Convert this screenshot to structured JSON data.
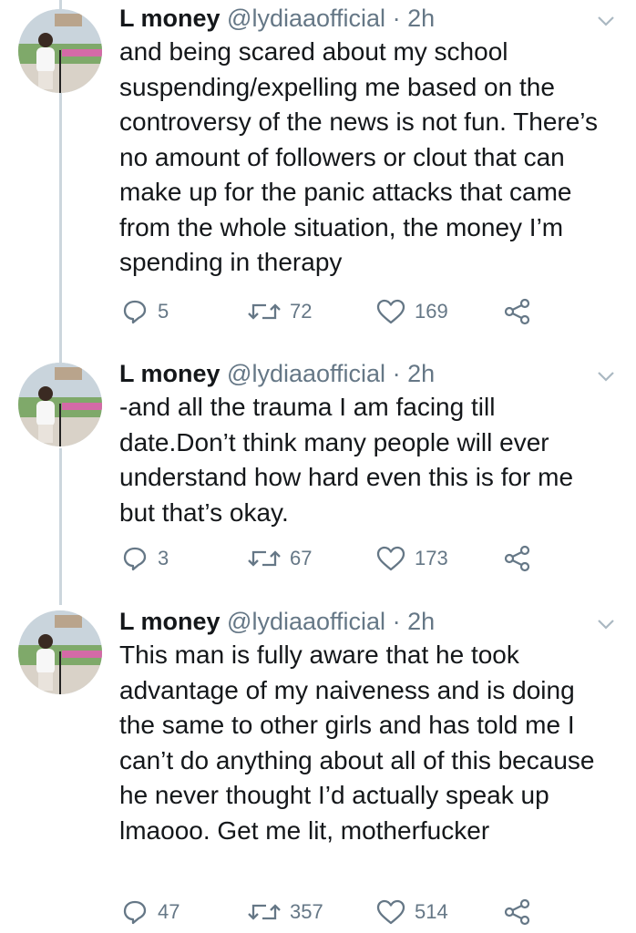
{
  "tweets": [
    {
      "name": "L money",
      "handle": "@lydiaaofficial",
      "separator": "·",
      "time": "2h",
      "text": "and being scared about my school suspending/expelling me based on the controversy of the news is not fun. There’s no amount of followers or clout that can make up for the panic attacks that came from the whole situation, the money I’m spending in therapy",
      "replies": "5",
      "retweets": "72",
      "likes": "169"
    },
    {
      "name": "L money",
      "handle": "@lydiaaofficial",
      "separator": "·",
      "time": "2h",
      "text": "-and all the trauma I am facing till date.Don’t think many people will ever understand how hard even this is for me but that’s okay.",
      "replies": "3",
      "retweets": "67",
      "likes": "173"
    },
    {
      "name": "L money",
      "handle": "@lydiaaofficial",
      "separator": "·",
      "time": "2h",
      "text": "This man is fully aware that he took advantage of my naiveness and is doing the same to other girls and has told me I can’t do anything about all of this because he never thought I’d actually speak up lmaooo. Get me lit, motherfucker",
      "replies": "47",
      "retweets": "357",
      "likes": "514"
    }
  ],
  "colors": {
    "text": "#14171a",
    "secondary": "#657786",
    "thread_line": "#ccd6dd",
    "chevron": "#aab8c2"
  },
  "icons": [
    "reply-icon",
    "retweet-icon",
    "like-icon",
    "share-icon",
    "chevron-down-icon"
  ]
}
